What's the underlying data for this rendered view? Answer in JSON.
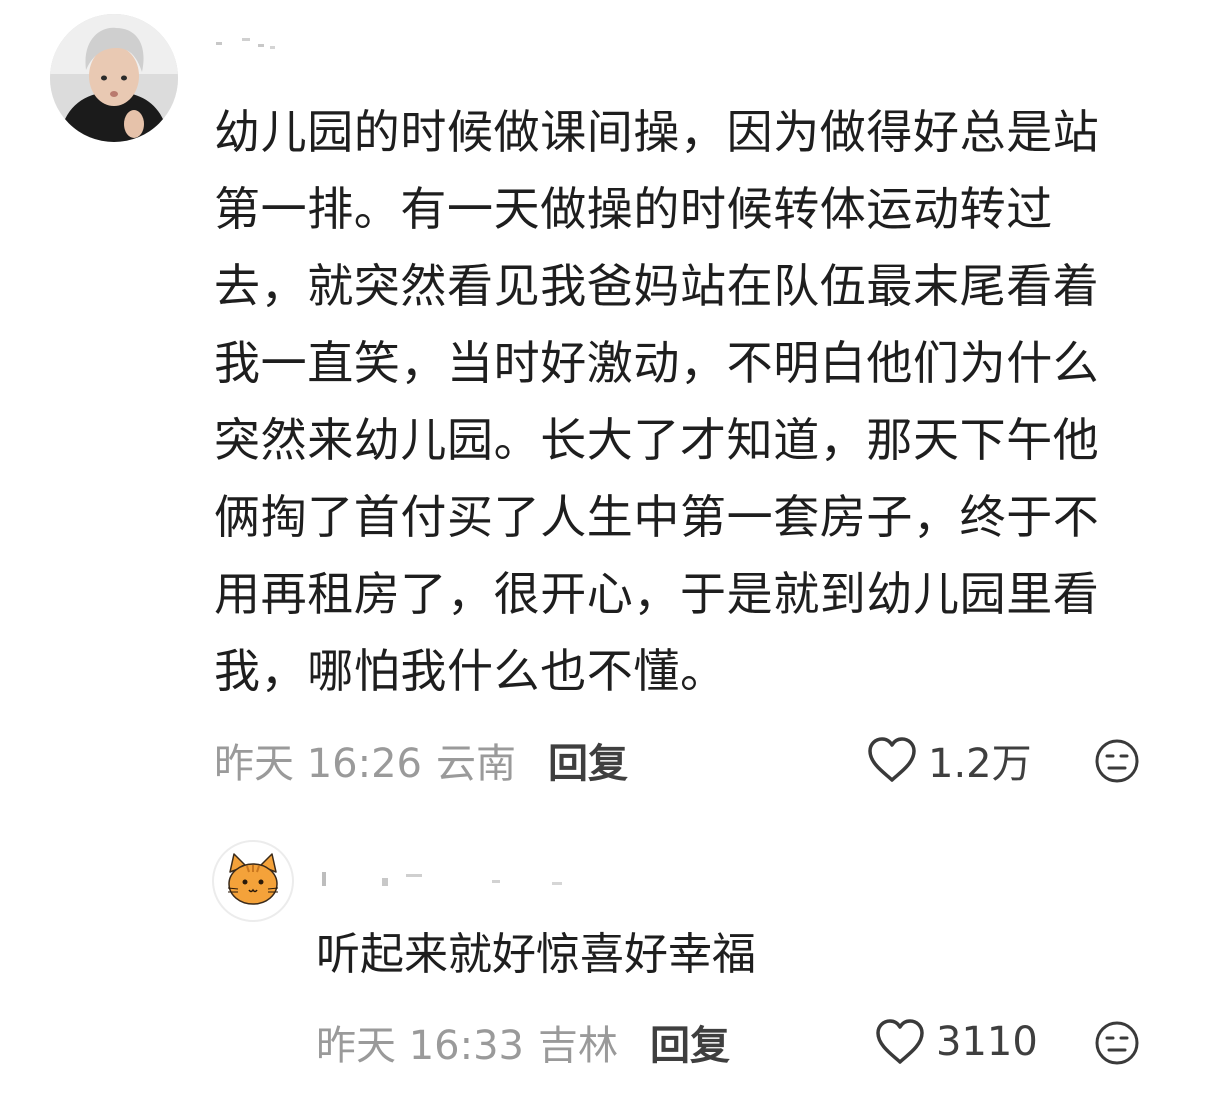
{
  "comment": {
    "avatar_icon": "user-avatar-photo",
    "text": "幼儿园的时候做课间操，因为做得好总是站\n第一排。有一天做操的时候转体运动转过\n去，就突然看见我爸妈站在队伍最末尾看着\n我一直笑，当时好激动，不明白他们为什么\n突然来幼儿园。长大了才知道，那天下午他\n俩掏了首付买了人生中第一套房子，终于不\n用再租房了，很开心，于是就到幼儿园里看\n我，哪怕我什么也不懂。",
    "time": "昨天 16:26",
    "location": "云南",
    "reply_label": "回复",
    "like_icon": "heart-outline-icon",
    "like_count": "1.2万",
    "dislike_icon": "meh-face-icon"
  },
  "reply": {
    "avatar_icon": "orange-cat-avatar",
    "text": "听起来就好惊喜好幸福",
    "time": "昨天 16:33",
    "location": "吉林",
    "reply_label": "回复",
    "like_icon": "heart-outline-icon",
    "like_count": "3110",
    "dislike_icon": "meh-face-icon"
  },
  "colors": {
    "text_primary": "#1e1e1e",
    "text_meta": "#9a9a9a",
    "text_action": "#3f3f3f",
    "cat_orange": "#f4a23a"
  }
}
